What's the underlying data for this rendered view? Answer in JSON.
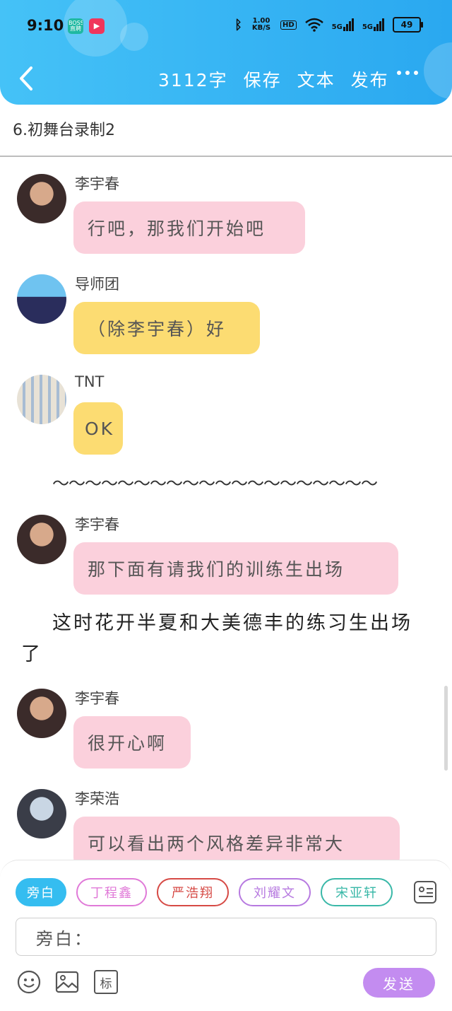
{
  "status_bar": {
    "time": "9:10",
    "app_icon_1": "BOSS 直聘",
    "network_speed": "1.00 KB/S",
    "hd_badge": "HD",
    "signal_1": "5G",
    "signal_2": "5G",
    "battery": "49"
  },
  "toolbar": {
    "word_count": "3112字",
    "save_label": "保存",
    "text_label": "文本",
    "publish_label": "发布"
  },
  "chapter_title": "6.初舞台录制2",
  "messages": [
    {
      "name": "李宇春",
      "text": "行吧，那我们开始吧",
      "bubble_color": "#fbd0dc",
      "avatar_colors": [
        "#d7a98b",
        "#3b2b2a"
      ]
    },
    {
      "name": "导师团",
      "text": "（除李宇春）好",
      "bubble_color": "#fcdc72",
      "avatar_colors": [
        "#6fc3f0",
        "#2a2d5c"
      ]
    },
    {
      "name": "TNT",
      "text": "OK",
      "bubble_color": "#fcdc72",
      "avatar_colors": [
        "#e8e2d6",
        "#6b8fb5"
      ]
    },
    {
      "name": "李宇春",
      "text": "那下面有请我们的训练生出场",
      "bubble_color": "#fbd0dc",
      "avatar_colors": [
        "#d7a98b",
        "#3b2b2a"
      ]
    },
    {
      "name": "李宇春",
      "text": "很开心啊",
      "bubble_color": "#fbd0dc",
      "avatar_colors": [
        "#d7a98b",
        "#3b2b2a"
      ]
    },
    {
      "name": "李荣浩",
      "text": "可以看出两个风格差异非常大",
      "bubble_color": "#fbd0dc",
      "avatar_colors": [
        "#c9d6e4",
        "#3a3d48"
      ]
    }
  ],
  "divider": "～～～～～～～～～～～～～～～～～～～～",
  "narration": "这时花开半夏和大美德丰的练习生出场了",
  "role_chips": [
    {
      "label": "旁白",
      "color": "#35bdf0"
    },
    {
      "label": "丁程鑫",
      "color": "#e07ad8"
    },
    {
      "label": "严浩翔",
      "color": "#d64a45"
    },
    {
      "label": "刘耀文",
      "color": "#b77ae0"
    },
    {
      "label": "宋亚轩",
      "color": "#3ab8a8"
    }
  ],
  "input": {
    "value": "旁白："
  },
  "send_label": "发送",
  "tools": {
    "emoji": "smiley-icon",
    "image": "image-icon",
    "mark": "标"
  }
}
